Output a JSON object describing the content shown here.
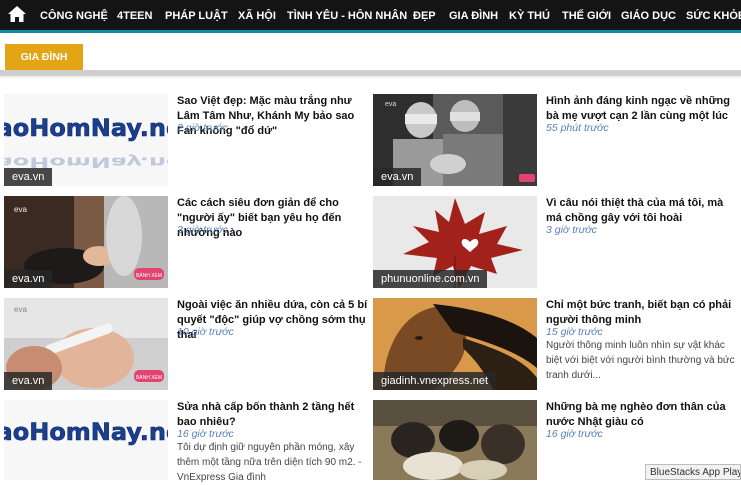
{
  "nav": {
    "items": [
      "CÔNG NGHỆ",
      "4TEEN",
      "PHÁP LUẬT",
      "XÃ HỘI",
      "TÌNH YÊU - HÔN NHÂN",
      "ĐẸP",
      "GIA ĐÌNH",
      "KỲ THÚ",
      "THẾ GIỚI",
      "GIÁO DỤC",
      "SỨC KHỎE"
    ]
  },
  "section": {
    "title": "GIA ĐÌNH"
  },
  "articles": [
    {
      "title": "Sao Việt đẹp: Mặc màu trắng như Lâm Tâm Như, Khánh My bảo sao Fan không \"đổ dứ\"",
      "time": "2 giờ trước",
      "source": "eva.vn",
      "snippet": "",
      "logo": "BaoHomNay.net"
    },
    {
      "title": "Hình ảnh đáng kinh ngạc về những bà mẹ vượt cạn 2 lần cùng một lúc",
      "time": "55 phút trước",
      "source": "eva.vn",
      "snippet": "",
      "badge": "BÁNH XEM"
    },
    {
      "title": "Các cách siêu đơn giản để cho \"người ấy\" biết bạn yêu họ đến nhường nào",
      "time": "3 giờ trước",
      "source": "eva.vn",
      "snippet": "",
      "badge": "BÁNH XEM"
    },
    {
      "title": "Vì câu nói thiệt thà của má tôi, mà má chồng gây với tôi hoài",
      "time": "3 giờ trước",
      "source": "phunuonline.com.vn",
      "snippet": ""
    },
    {
      "title": "Ngoài việc ăn nhiều dứa, còn cả 5 bí quyết \"độc\" giúp vợ chồng sớm thụ thai",
      "time": "10 giờ trước",
      "source": "eva.vn",
      "snippet": "",
      "badge": "BÁNH XEM"
    },
    {
      "title": "Chỉ một bức tranh, biết bạn có phải người thông minh",
      "time": "15 giờ trước",
      "source": "giadinh.vnexpress.net",
      "snippet": "Người thông minh luôn nhìn sự vật khác biệt với biệt với người bình thường và bức tranh dưới..."
    },
    {
      "title": "Sửa nhà cấp bốn thành 2 tầng hết bao nhiêu?",
      "time": "16 giờ trước",
      "source": "",
      "snippet": "Tôi dự định giữ nguyên phần móng, xây thêm một tầng nữa trên diện tích 90 m2. - VnExpress Gia đình",
      "logo": "BaoHomNay.net"
    },
    {
      "title": "Những bà mẹ nghèo đơn thân của nước Nhật giàu có",
      "time": "16 giờ trước",
      "source": "",
      "snippet": ""
    }
  ],
  "overlay": {
    "label": "BlueStacks App Player"
  },
  "colors": {
    "nav_bg": "#141414",
    "nav_accent": "#0d8aa8",
    "section_tab": "#e3a416",
    "time_text": "#5a7fb8"
  }
}
